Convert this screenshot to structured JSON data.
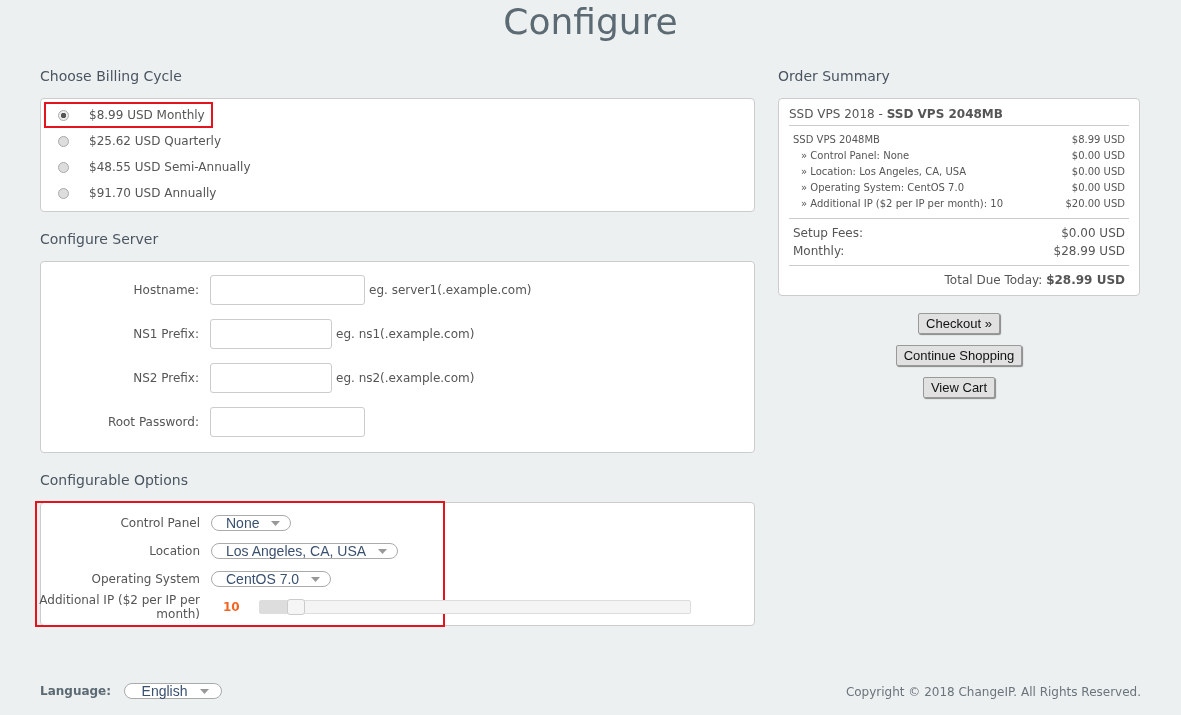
{
  "page_title": "Configure",
  "billing": {
    "heading": "Choose Billing Cycle",
    "options": [
      {
        "label": "$8.99 USD Monthly",
        "selected": true,
        "highlighted": true
      },
      {
        "label": "$25.62 USD Quarterly",
        "selected": false,
        "highlighted": false
      },
      {
        "label": "$48.55 USD Semi-Annually",
        "selected": false,
        "highlighted": false
      },
      {
        "label": "$91.70 USD Annually",
        "selected": false,
        "highlighted": false
      }
    ]
  },
  "server": {
    "heading": "Configure Server",
    "fields": [
      {
        "label": "Hostname:",
        "hint": "eg. server1(.example.com)",
        "wide": true
      },
      {
        "label": "NS1 Prefix:",
        "hint": "eg. ns1(.example.com)",
        "wide": false
      },
      {
        "label": "NS2 Prefix:",
        "hint": "eg. ns2(.example.com)",
        "wide": false
      },
      {
        "label": "Root Password:",
        "wide": true
      }
    ]
  },
  "options": {
    "heading": "Configurable Options",
    "highlighted": true,
    "items": [
      {
        "kind": "select",
        "label": "Control Panel",
        "value": "None"
      },
      {
        "kind": "select",
        "label": "Location",
        "value": "Los Angeles, CA, USA"
      },
      {
        "kind": "select",
        "label": "Operating System",
        "value": "CentOS 7.0"
      },
      {
        "kind": "slider",
        "label": "Additional IP ($2 per IP per month)",
        "value": "10",
        "level": 0.07
      }
    ]
  },
  "summary": {
    "heading": "Order Summary",
    "title": "SSD VPS 2018 - **SSD VPS 2048MB**",
    "lines": [
      {
        "label": "SSD VPS 2048MB",
        "price": "$8.99 USD",
        "sub": false
      },
      {
        "label": "» Control Panel: None",
        "price": "$0.00 USD",
        "sub": true
      },
      {
        "label": "» Location: Los Angeles, CA, USA",
        "price": "$0.00 USD",
        "sub": true
      },
      {
        "label": "» Operating System: CentOS 7.0",
        "price": "$0.00 USD",
        "sub": true
      },
      {
        "label": "» Additional IP ($2 per IP per month): 10",
        "price": "$20.00 USD",
        "sub": true
      }
    ],
    "totals": [
      {
        "label": "Setup Fees:",
        "price": "$0.00 USD"
      },
      {
        "label": "Monthly:",
        "price": "$28.99 USD"
      }
    ],
    "total_due": "Total Due Today: **$28.99 USD**"
  },
  "buttons": [
    "Checkout »",
    "Continue Shopping",
    "View Cart"
  ],
  "footer": {
    "language_label": "Language:",
    "language": "English",
    "copyright": "Copyright © 2018 ChangeIP. All Rights Reserved."
  }
}
